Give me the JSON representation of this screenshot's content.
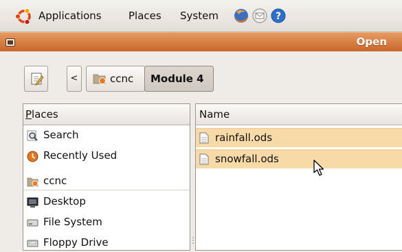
{
  "panel": {
    "menus": [
      "Applications",
      "Places",
      "System"
    ],
    "icons": [
      "ubuntu-logo-icon",
      "firefox-icon",
      "mail-icon",
      "help-icon"
    ]
  },
  "window": {
    "title": "Open"
  },
  "toolbar": {
    "edit_icon": "pencil-notepad-icon",
    "back_label": "<",
    "path": [
      "ccnc",
      "Module 4"
    ]
  },
  "places": {
    "header": "Places",
    "header_underline": "P",
    "header_rest": "laces",
    "items": [
      {
        "label": "Search",
        "icon": "search-icon"
      },
      {
        "label": "Recently Used",
        "icon": "recent-icon"
      },
      {
        "label": "ccnc",
        "icon": "home-folder-icon"
      },
      {
        "label": "Desktop",
        "icon": "desktop-icon"
      },
      {
        "label": "File System",
        "icon": "drive-icon"
      },
      {
        "label": "Floppy Drive",
        "icon": "floppy-icon"
      }
    ]
  },
  "files": {
    "header": "Name",
    "rows": [
      {
        "name": "rainfall.ods",
        "icon": "spreadsheet-file-icon"
      },
      {
        "name": "snowfall.ods",
        "icon": "spreadsheet-file-icon"
      }
    ]
  },
  "colors": {
    "titlebar": "#d9793d",
    "selection": "#f8d9a8",
    "background": "#efebe7"
  }
}
